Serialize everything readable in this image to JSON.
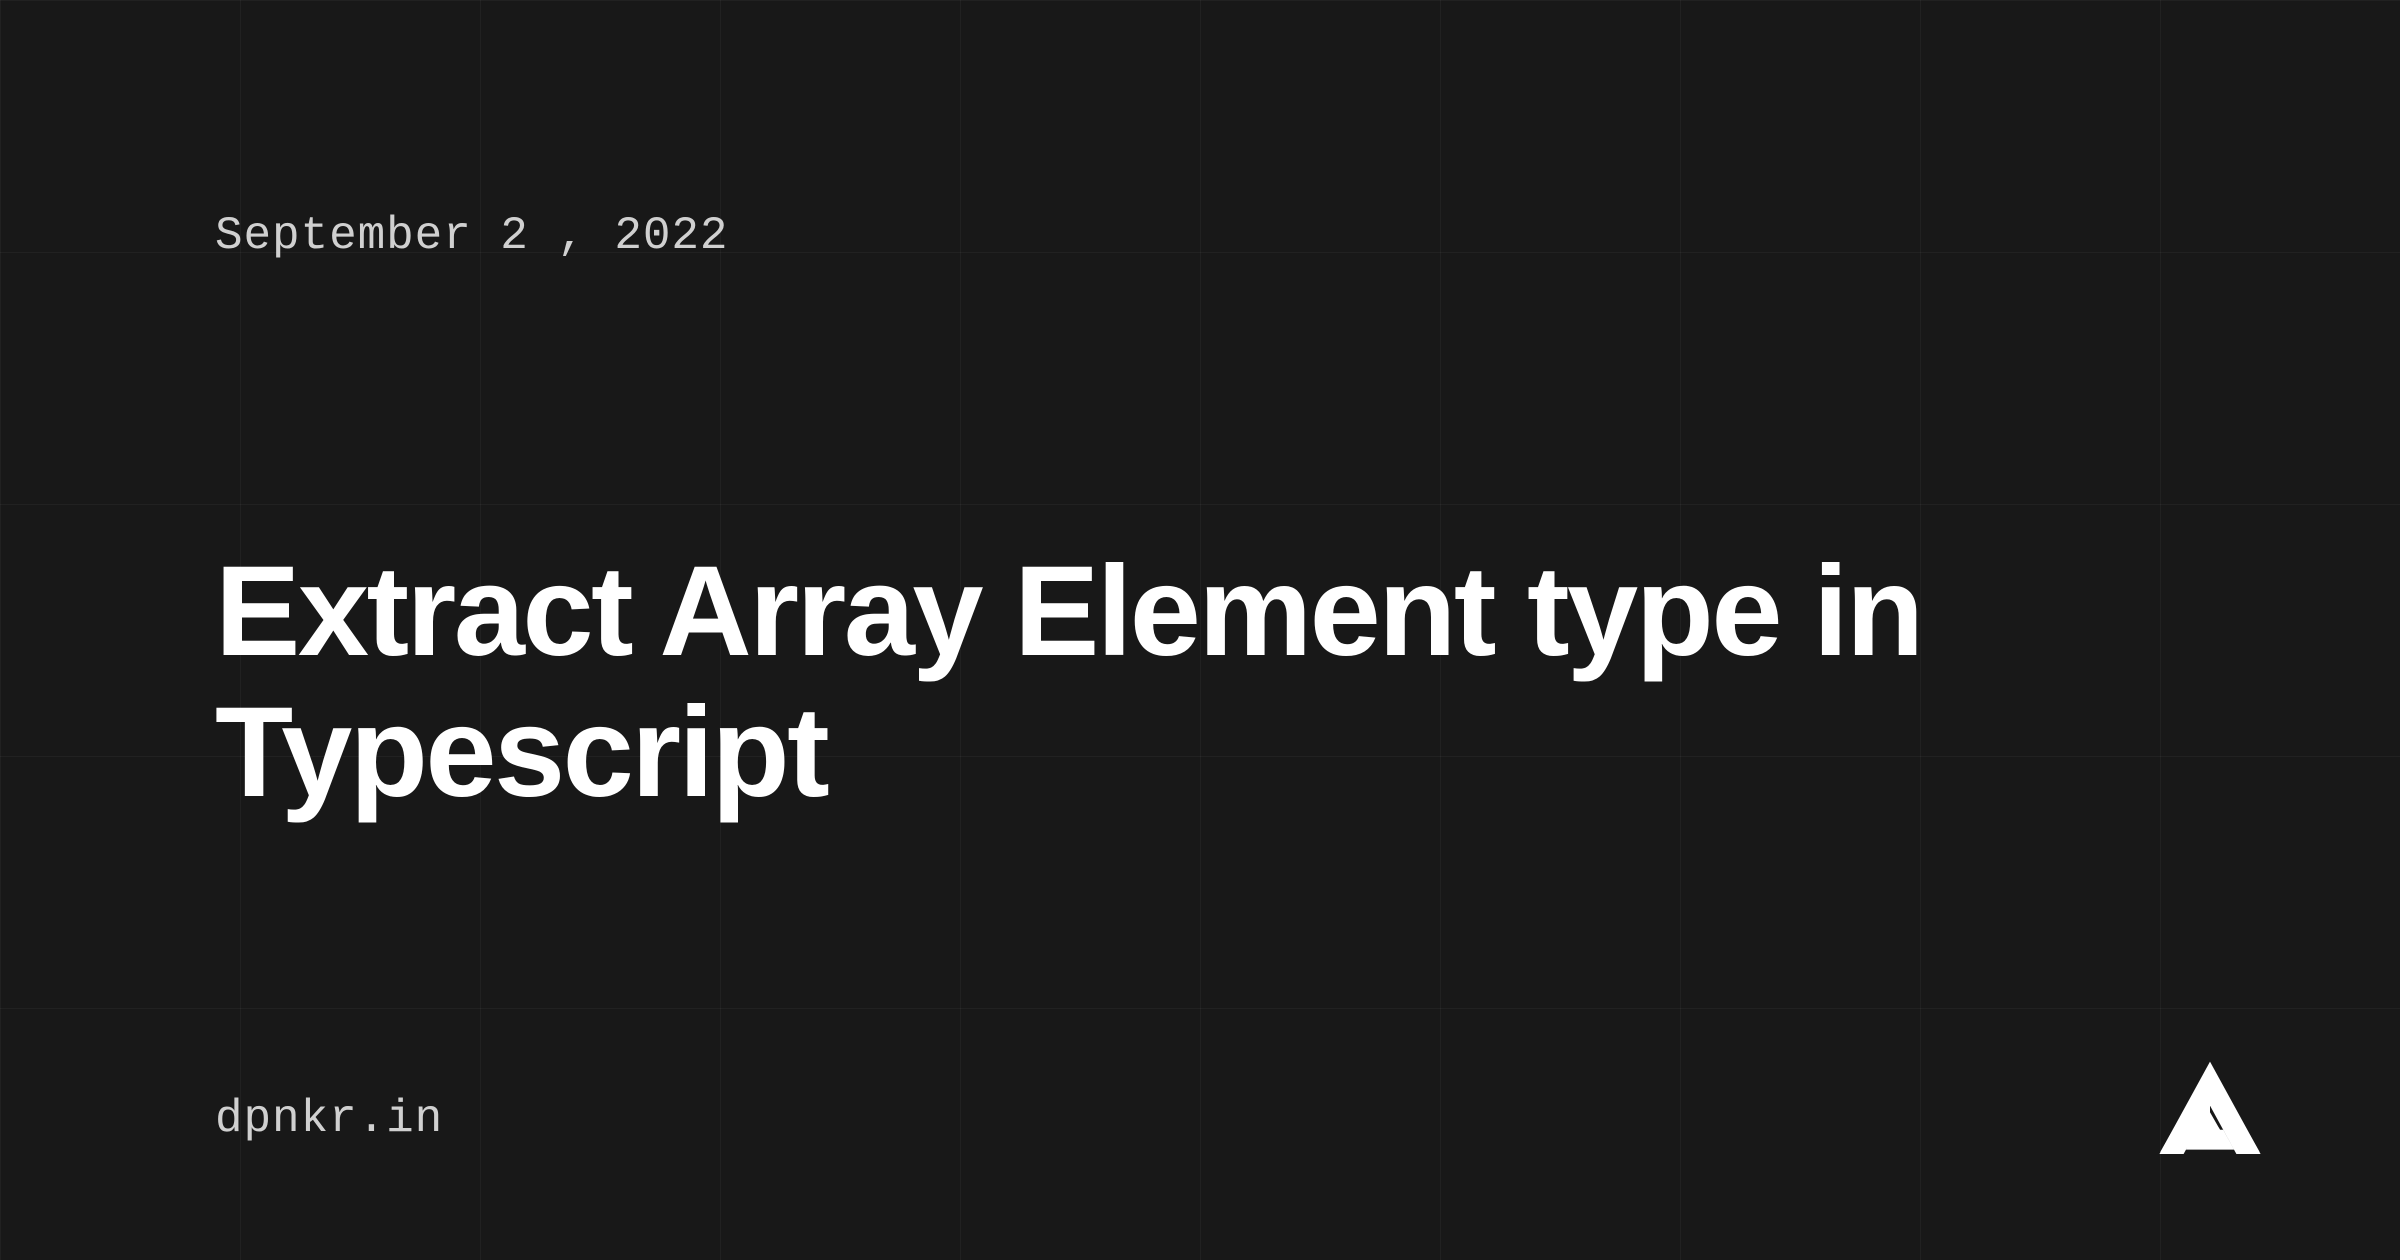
{
  "date": "September 2 , 2022",
  "title": "Extract Array Element type in Typescript",
  "domain": "dpnkr.in"
}
